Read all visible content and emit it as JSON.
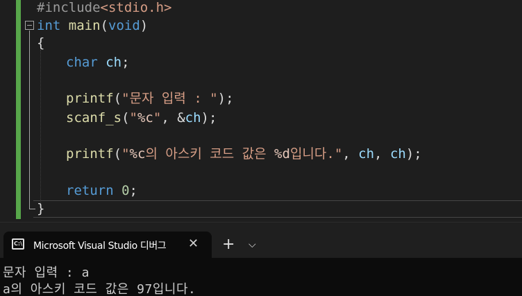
{
  "editor": {
    "line_include": {
      "directive": "#include",
      "header": "<stdio.h>"
    },
    "line_main": {
      "ret_type": "int",
      "name": "main",
      "open": "(",
      "param": "void",
      "close": ")"
    },
    "line_open_brace": "{",
    "line_decl": {
      "type": "char",
      "var": "ch",
      "end": ";"
    },
    "line_printf1": {
      "fn": "printf",
      "open": "(",
      "str": "\"문자 입력 : \"",
      "close": ");"
    },
    "line_scanf": {
      "fn": "scanf_s",
      "open": "(",
      "q1": "\"",
      "fmt": "%c",
      "q2": "\"",
      "sep": ", &",
      "var": "ch",
      "close": ");"
    },
    "line_printf2": {
      "fn": "printf",
      "open": "(",
      "q1": "\"",
      "fmt1": "%c",
      "mid": "의 아스키 코드 값은 ",
      "fmt2": "%d",
      "tail": "입니다.\"",
      "sep1": ", ",
      "var1": "ch",
      "sep2": ", ",
      "var2": "ch",
      "close": ");"
    },
    "line_return": {
      "kw": "return",
      "num": "0",
      "end": ";"
    },
    "line_close_brace": "}"
  },
  "tabbar": {
    "tab_title": "Microsoft Visual Studio 디버그",
    "tab_icon_text": "C:\\",
    "close_glyph": "✕",
    "new_tab_glyph": "+",
    "dropdown_glyph": "⌵"
  },
  "console": {
    "lines": [
      "문자 입력 : a",
      "a의 아스키 코드 값은 97입니다."
    ]
  },
  "colors": {
    "editor_bg": "#1e1e1e",
    "change_bar": "#57a64a",
    "keyword": "#569cd6",
    "function": "#dcdcaa",
    "string": "#d69d85",
    "variable": "#9cdcfe",
    "number": "#b5cea8",
    "console_bg": "#0c0c0c"
  }
}
